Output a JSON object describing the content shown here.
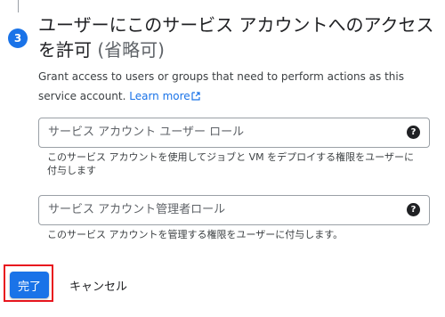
{
  "step": {
    "number": "3",
    "title": "ユーザーにこのサービス アカウントへのアクセスを許可",
    "optional": "(省略可)"
  },
  "description": {
    "text": "Grant access to users or groups that need to perform actions as this service account.",
    "learn_more": "Learn more"
  },
  "fields": [
    {
      "placeholder": "サービス アカウント ユーザー ロール",
      "help": "?",
      "hint": "このサービス アカウントを使用してジョブと VM をデプロイする権限をユーザーに付与します"
    },
    {
      "placeholder": "サービス アカウント管理者ロール",
      "help": "?",
      "hint": "このサービス アカウントを管理する権限をユーザーに付与します。"
    }
  ],
  "actions": {
    "done": "完了",
    "cancel": "キャンセル"
  },
  "colors": {
    "accent": "#1a73e8",
    "highlight_border": "#e8161e"
  }
}
